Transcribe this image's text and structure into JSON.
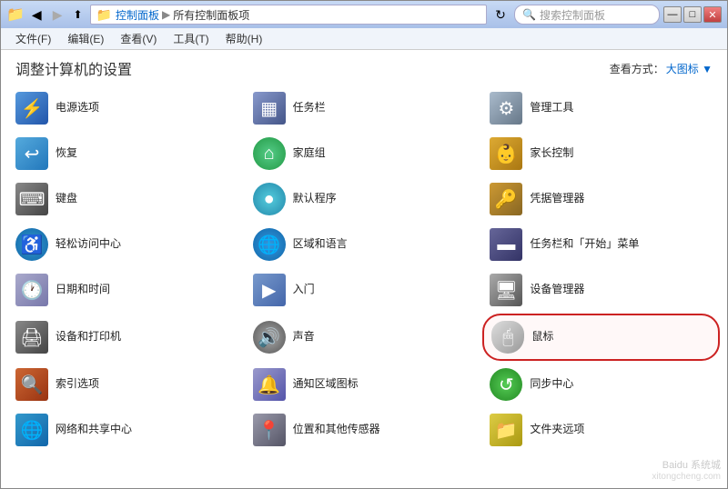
{
  "window": {
    "title": "所有控制面板项",
    "min_btn": "—",
    "max_btn": "□",
    "close_btn": "✕"
  },
  "addressbar": {
    "back_tooltip": "后退",
    "forward_tooltip": "前进",
    "breadcrumb": [
      "控制面板",
      "所有控制面板项"
    ],
    "search_placeholder": "搜索控制面板"
  },
  "menubar": {
    "items": [
      {
        "label": "文件(F)"
      },
      {
        "label": "编辑(E)"
      },
      {
        "label": "查看(V)"
      },
      {
        "label": "工具(T)"
      },
      {
        "label": "帮助(H)"
      }
    ]
  },
  "content": {
    "title": "调整计算机的设置",
    "view_label": "查看方式：",
    "view_mode": "大图标 ▼"
  },
  "items": [
    {
      "label": "电源选项",
      "icon": "power"
    },
    {
      "label": "任务栏",
      "icon": "taskbar-old"
    },
    {
      "label": "管理工具",
      "icon": "admin"
    },
    {
      "label": "恢复",
      "icon": "restore"
    },
    {
      "label": "家庭组",
      "icon": "homegroup"
    },
    {
      "label": "家长控制",
      "icon": "parental"
    },
    {
      "label": "键盘",
      "icon": "keyboard"
    },
    {
      "label": "默认程序",
      "icon": "default-prog"
    },
    {
      "label": "凭据管理器",
      "icon": "credential"
    },
    {
      "label": "轻松访问中心",
      "icon": "easy-access"
    },
    {
      "label": "区域和语言",
      "icon": "region"
    },
    {
      "label": "任务栏和「开始」菜单",
      "icon": "taskbar"
    },
    {
      "label": "日期和时间",
      "icon": "datetime"
    },
    {
      "label": "入门",
      "icon": "intro"
    },
    {
      "label": "设备管理器",
      "icon": "device-mgr"
    },
    {
      "label": "设备和打印机",
      "icon": "device-printer"
    },
    {
      "label": "声音",
      "icon": "sound"
    },
    {
      "label": "鼠标",
      "icon": "mouse",
      "highlighted": true
    },
    {
      "label": "索引选项",
      "icon": "index"
    },
    {
      "label": "通知区域图标",
      "icon": "notification"
    },
    {
      "label": "同步中心",
      "icon": "sync"
    },
    {
      "label": "网络和共享中心",
      "icon": "network"
    },
    {
      "label": "位置和其他传感器",
      "icon": "location"
    },
    {
      "label": "文件夹远项",
      "icon": "folder-remote"
    }
  ],
  "watermark": "Baidu 系统城\nxitongcheng.com"
}
